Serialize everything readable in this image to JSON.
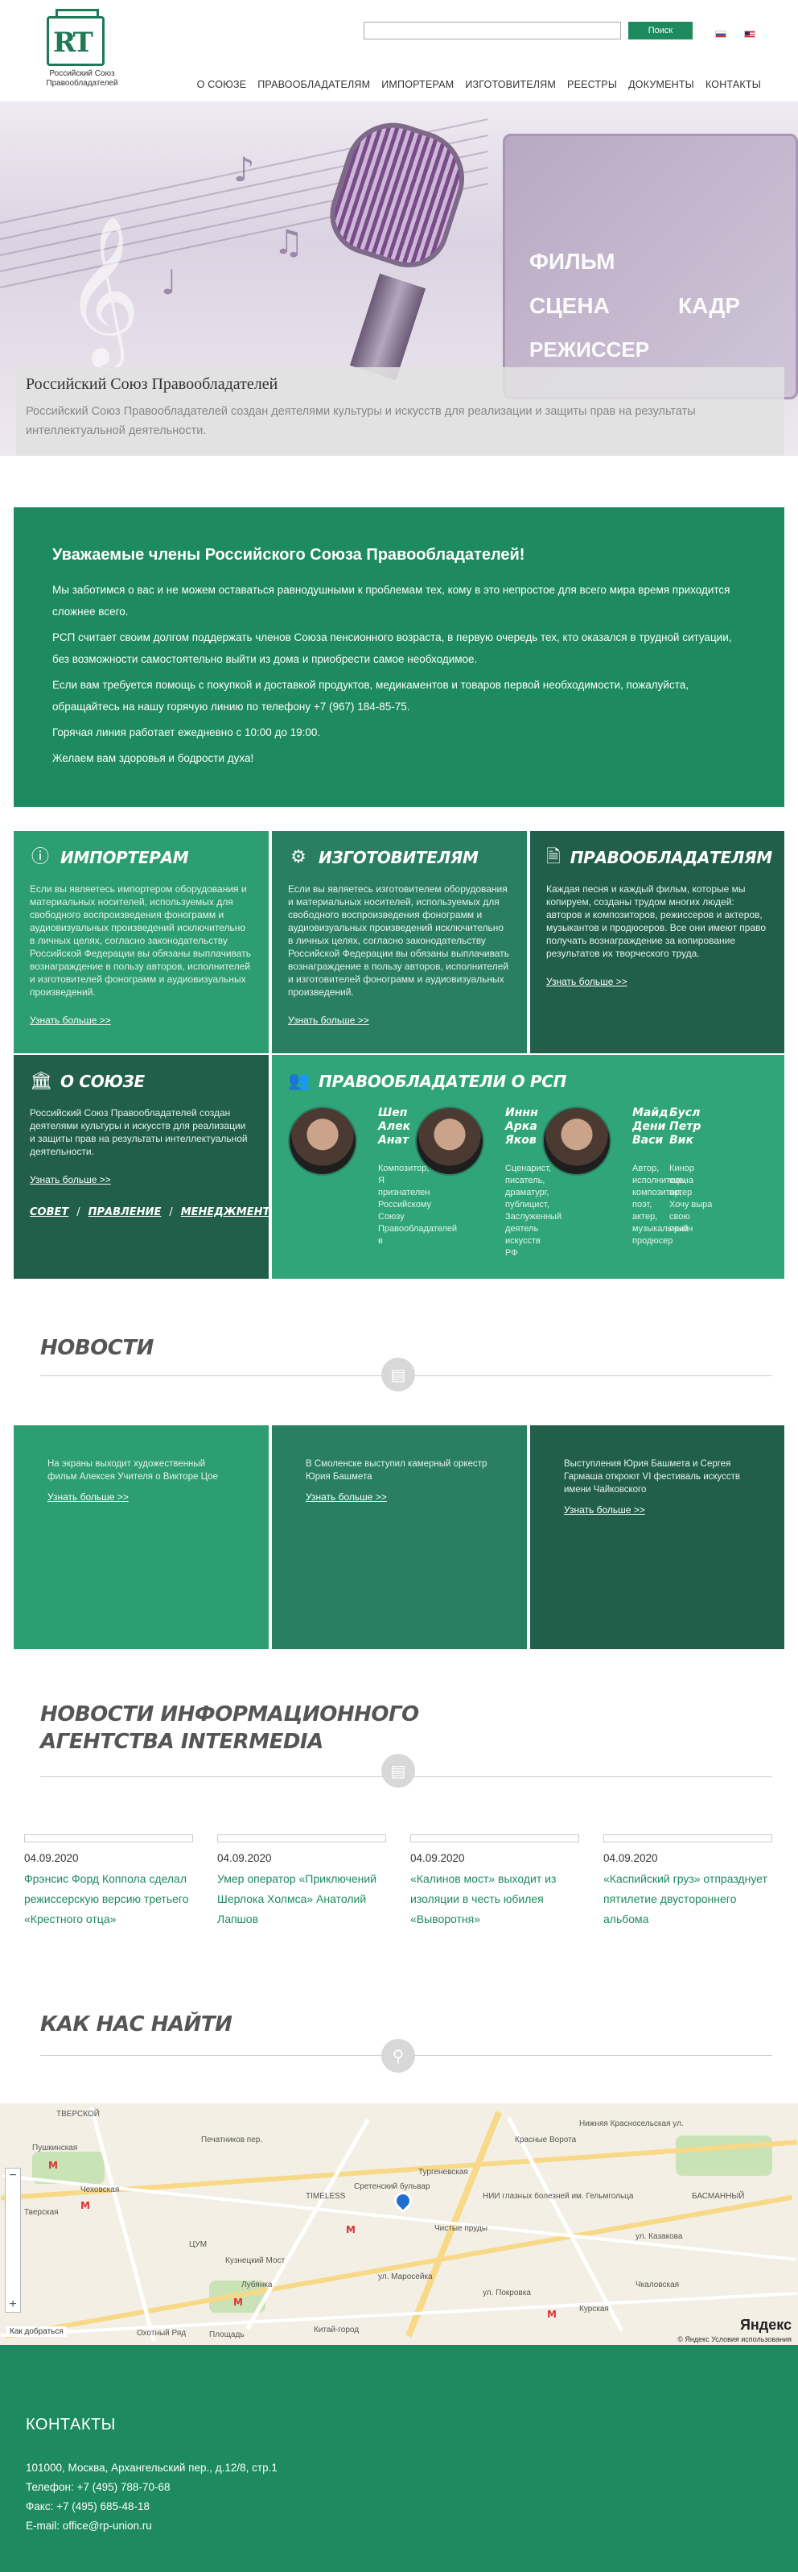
{
  "header": {
    "logo_text_line1": "Российский Союз",
    "logo_text_line2": "Правообладателей",
    "logo_mark": "RT",
    "search_placeholder": "",
    "search_button": "Поиск",
    "nav": [
      "О СОЮЗЕ",
      "ПРАВООБЛАДАТЕЛЯМ",
      "ИМПОРТЕРАМ",
      "ИЗГОТОВИТЕЛЯМ",
      "РЕЕСТРЫ",
      "ДОКУМЕНТЫ",
      "КОНТАКТЫ"
    ]
  },
  "hero": {
    "clapper_words": [
      "ФИЛЬМ",
      "СЦЕНА",
      "КАДР",
      "РЕЖИССЕР"
    ],
    "title": "Российский Союз Правообладателей",
    "text": "Российский Союз Правообладателей создан деятелями культуры и искусств для реализации и защиты прав на результаты интеллектуальной деятельности."
  },
  "announcement": {
    "title": "Уважаемые члены Российского Союза Правообладателей!",
    "paragraphs": [
      "Мы заботимся о вас и не можем оставаться равнодушными к проблемам тех, кому в это непростое для всего мира время приходится сложнее всего.",
      "РСП считает своим долгом поддержать членов Союза пенсионного возраста, в первую очередь тех, кто оказался в трудной ситуации, без возможности самостоятельно выйти из дома и приобрести самое необходимое.",
      "Если вам требуется помощь с покупкой и доставкой продуктов, медикаментов и товаров первой необходимости, пожалуйста, обращайтесь на нашу горячую линию по телефону +7 (967) 184-85-75.",
      "Горячая линия работает ежедневно с 10:00 до 19:00.",
      "Желаем вам здоровья и бодрости духа!"
    ]
  },
  "tiles": {
    "importers": {
      "title": "ИМПОРТЕРАМ",
      "text": "Если вы являетесь импортером оборудования и материальных носителей, используемых для свободного воспроизведения фонограмм и аудиовизуальных произведений исключительно в личных целях, согласно законодательству Российской Федерации вы обязаны выплачивать вознаграждение в пользу авторов, исполнителей и изготовителей фонограмм и аудиовизуальных произведений.",
      "more": "Узнать больше >>"
    },
    "manufacturers": {
      "title": "ИЗГОТОВИТЕЛЯМ",
      "text": "Если вы являетесь изготовителем оборудования и материальных носителей, используемых для свободного воспроизведения фонограмм и аудиовизуальных произведений исключительно в личных целях, согласно законодательству Российской Федерации вы обязаны выплачивать вознаграждение в пользу авторов, исполнителей и изготовителей фонограмм и аудиовизуальных произведений.",
      "more": "Узнать больше >>"
    },
    "rightholders": {
      "title": "ПРАВООБЛАДАТЕЛЯМ",
      "text": "Каждая песня и каждый фильм, которые мы копируем, созданы трудом многих людей: авторов и композиторов, режиссеров и актеров, музыкантов и продюсеров. Все они имеют право получать вознаграждение за копирование результатов их творческого труда.",
      "more": "Узнать больше >>"
    },
    "about": {
      "title": "О СОЮЗЕ",
      "text": "Российский Союз Правообладателей создан деятелями культуры и искусств для реализации и защиты прав на результаты интеллектуальной деятельности.",
      "more": "Узнать больше >>",
      "links": [
        "СОВЕТ",
        "ПРАВЛЕНИЕ",
        "МЕНЕДЖМЕНТ"
      ],
      "sep": "/"
    },
    "holders": {
      "title": "ПРАВООБЛАДАТЕЛИ О РСП",
      "people": [
        {
          "name": "Шеп Алек Анат",
          "text": "Композитор, Я признателен Российскому Союзу Правообладателей в"
        },
        {
          "name": "Иннн Арка Яков",
          "text": "Сценарист, писатель, драматург, публицист, Заслуженный деятель искусств РФ"
        },
        {
          "name": "Майд Дени Васи",
          "text": "Автор, исполнитель, композитор, поэт, актер, музыкальный продюсер"
        },
        {
          "name": "Бусл Петр Вик",
          "text": "Кинор сцена актер Хочу выра свою призн"
        }
      ]
    }
  },
  "news": {
    "heading": "НОВОСТИ",
    "items": [
      {
        "text": "На экраны выходит художественный фильм Алексея Учителя о Викторе Цое",
        "more": "Узнать больше >>"
      },
      {
        "text": "В Смоленске выступил камерный оркестр Юрия Башмета",
        "more": "Узнать больше >>"
      },
      {
        "text": "Выступления Юрия Башмета и Сергея Гармаша откроют VI фестиваль искусств имени Чайковского",
        "more": "Узнать больше >>"
      }
    ]
  },
  "intermedia": {
    "heading_line1": "НОВОСТИ ИНФОРМАЦИОННОГО",
    "heading_line2": "АГЕНТСТВА INTERMEDIA",
    "items": [
      {
        "date": "04.09.2020",
        "title": "Фрэнсис Форд Коппола сделал режиссерскую версию третьего «Крестного отца»"
      },
      {
        "date": "04.09.2020",
        "title": "Умер оператор «Приключений Шерлока Холмса» Анатолий Лапшов"
      },
      {
        "date": "04.09.2020",
        "title": "«Калинов мост» выходит из изоляции в честь юбилея «Выворотня»"
      },
      {
        "date": "04.09.2020",
        "title": "«Каспийский груз» отпразднует пятилетие двустороннего альбома"
      }
    ]
  },
  "find_us": {
    "heading": "КАК НАС НАЙТИ"
  },
  "map": {
    "labels": [
      "ТВЕРСКОЙ",
      "Пушкинская",
      "Чеховская",
      "Тверская",
      "Лубянка",
      "Кузнецкий Мост",
      "Охотный Ряд",
      "Площадь",
      "Китай-город",
      "Сретенский бульвар",
      "Красные Ворота",
      "Курская",
      "Чкаловская",
      "Тургеневская",
      "Чистые пруды",
      "БАСМАННЫЙ",
      "ул. Покровка",
      "ул. Маросейка",
      "ЦУМ",
      "TIMELESS",
      "ул. Казакова",
      "Печатников пер.",
      "Нижняя Красносельская ул.",
      "НИИ глазных болезней им. Гельмгольца"
    ],
    "route_label": "Как добраться",
    "logo": "Яндекс",
    "copyright": "© Яндекс  Условия использования"
  },
  "footer": {
    "title": "КОНТАКТЫ",
    "address": "101000, Москва, Архангельский пер., д.12/8, стр.1",
    "phone": "Телефон: +7 (495) 788-70-68",
    "fax": "Факс: +7 (495) 685-48-18",
    "email": "E-mail: office@rp-union.ru"
  },
  "colors": {
    "brand_green": "#1d8a60",
    "tile_light": "#2d9d72",
    "tile_mid": "#2a7f63",
    "tile_dark": "#215f4b"
  }
}
